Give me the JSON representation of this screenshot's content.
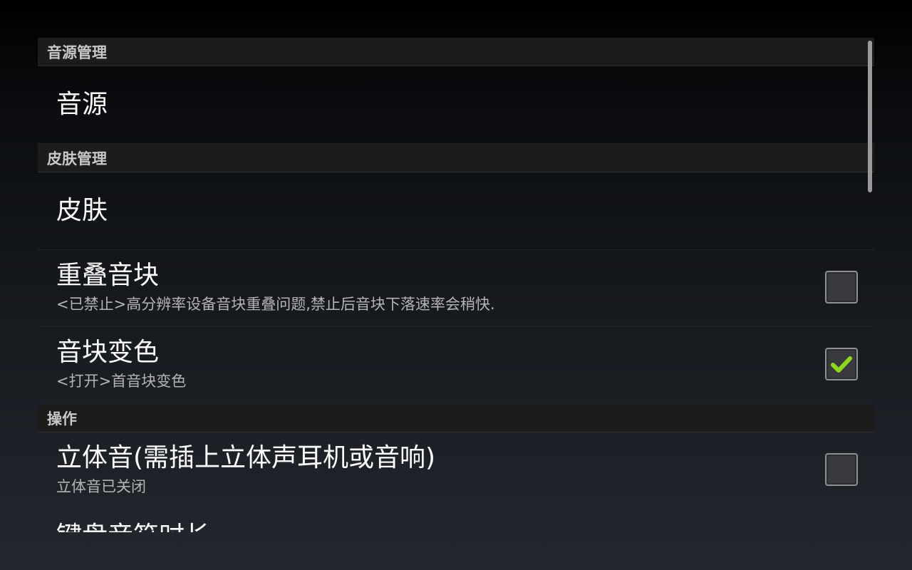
{
  "sections": [
    {
      "header": "音源管理",
      "items": [
        {
          "title": "音源"
        }
      ]
    },
    {
      "header": "皮肤管理",
      "items": [
        {
          "title": "皮肤"
        },
        {
          "title": "重叠音块",
          "summary": "<已禁止>高分辨率设备音块重叠问题,禁止后音块下落速率会稍快.",
          "checked": false
        },
        {
          "title": "音块变色",
          "summary": "<打开>首音块变色",
          "checked": true
        }
      ]
    },
    {
      "header": "操作",
      "items": [
        {
          "title": "立体音(需插上立体声耳机或音响)",
          "summary": "立体音已关闭",
          "checked": false
        },
        {
          "title": "键盘音符时长"
        }
      ]
    }
  ],
  "colors": {
    "check_mark": "#8fd61e",
    "category_background": "#1c1c1c"
  },
  "icons": {
    "checked": "check-mark-icon"
  }
}
